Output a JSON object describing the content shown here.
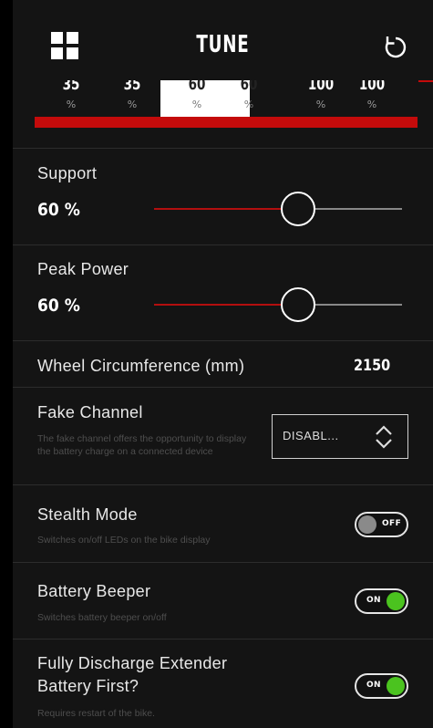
{
  "header": {
    "title": "TUNE",
    "menu_icon": "grid-icon",
    "reset_icon": "refresh-icon"
  },
  "modes": [
    {
      "value": "35",
      "unit": "%",
      "active": false
    },
    {
      "value": "35",
      "unit": "%",
      "active": false
    },
    {
      "value": "60",
      "unit": "%",
      "active": true
    },
    {
      "value": "60",
      "unit": "%",
      "active": true
    },
    {
      "value": "100",
      "unit": "%",
      "active": false
    },
    {
      "value": "100",
      "unit": "%",
      "active": false
    }
  ],
  "support": {
    "label": "Support",
    "value": "60 %",
    "level": 0.6
  },
  "peak_power": {
    "label": "Peak Power",
    "value": "60 %",
    "level": 0.6
  },
  "wheel": {
    "label": "Wheel Circumference (mm)",
    "value": "2150"
  },
  "fake_channel": {
    "label": "Fake Channel",
    "description": "The fake channel offers the opportunity to display the battery charge on a connected device",
    "selected": "DISABL..."
  },
  "stealth_mode": {
    "label": "Stealth Mode",
    "description": "Switches on/off LEDs on the bike display",
    "state": "OFF"
  },
  "battery_beeper": {
    "label": "Battery Beeper",
    "description": "Switches battery beeper on/off",
    "state": "ON"
  },
  "discharge_extender": {
    "label_line1": "Fully Discharge Extender",
    "label_line2": "Battery First?",
    "description": "Requires restart of the bike.",
    "state": "ON"
  },
  "colors": {
    "accent_red": "#c40b0b",
    "toggle_on": "#4bc31f",
    "toggle_off": "#8a8a8a"
  }
}
